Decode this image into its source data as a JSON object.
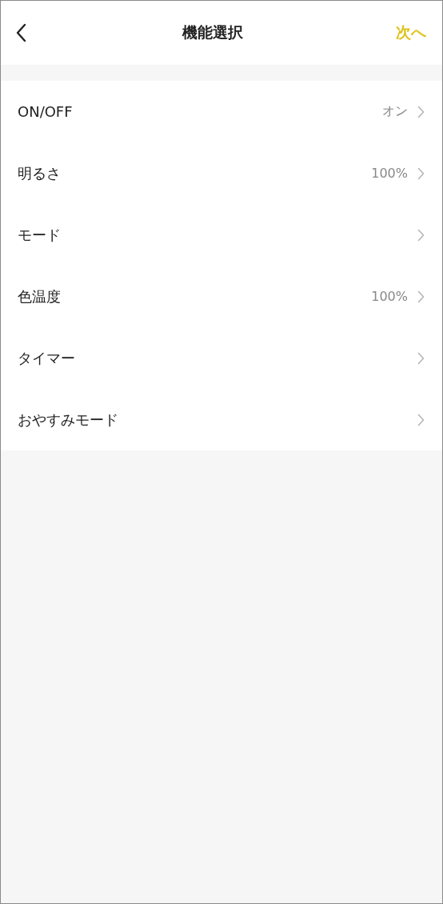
{
  "header": {
    "title": "機能選択",
    "next": "次へ"
  },
  "items": [
    {
      "label": "ON/OFF",
      "value": "オン"
    },
    {
      "label": "明るさ",
      "value": "100%"
    },
    {
      "label": "モード"
    },
    {
      "label": "色温度",
      "value": "100%"
    },
    {
      "label": "タイマー"
    },
    {
      "label": "おやすみモード"
    }
  ]
}
